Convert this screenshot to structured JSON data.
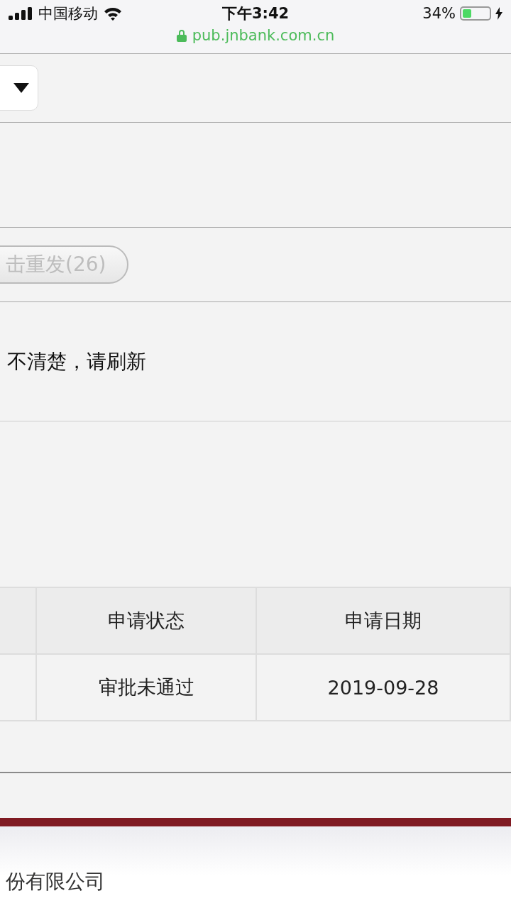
{
  "status_bar": {
    "carrier": "中国移动",
    "time": "下午3:42",
    "battery_percent": "34%",
    "battery": {
      "level": 0.34,
      "charging": true
    }
  },
  "address_bar": {
    "url": "pub.jnbank.com.cn",
    "secure": true
  },
  "resend_button": {
    "label": "击重发(26)",
    "disabled": true
  },
  "hint": "不清楚，请刷新",
  "table": {
    "columns": [
      "申请状态",
      "申请日期"
    ],
    "rows": [
      [
        "审批未通过",
        "2019-09-28"
      ]
    ]
  },
  "footer": {
    "text": "份有限公司"
  }
}
